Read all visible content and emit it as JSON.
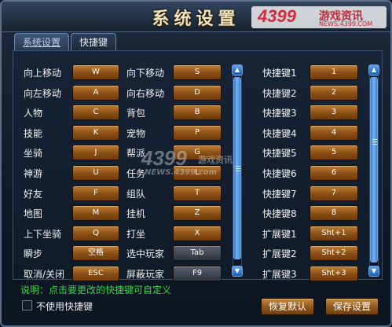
{
  "window": {
    "title": "系统设置"
  },
  "watermark": {
    "brand": "4399",
    "site": "游戏资讯",
    "url": "NEWS.4399.COM"
  },
  "center_watermark": {
    "brand": "4399",
    "site": "游戏资讯",
    "url": "NEWS.4399.com"
  },
  "tabs": [
    {
      "label": "系统设置",
      "active": true
    },
    {
      "label": "快捷键",
      "active": false
    }
  ],
  "bindings_left": [
    {
      "label": "向上移动",
      "key": "W"
    },
    {
      "label": "向左移动",
      "key": "A"
    },
    {
      "label": "人物",
      "key": "C"
    },
    {
      "label": "技能",
      "key": "K"
    },
    {
      "label": "坐骑",
      "key": "J"
    },
    {
      "label": "神游",
      "key": "U"
    },
    {
      "label": "好友",
      "key": "F"
    },
    {
      "label": "地图",
      "key": "M"
    },
    {
      "label": "上下坐骑",
      "key": "Q"
    },
    {
      "label": "瞬步",
      "key": "空格"
    },
    {
      "label": "取消/关闭",
      "key": "ESC"
    }
  ],
  "bindings_mid": [
    {
      "label": "向下移动",
      "key": "S"
    },
    {
      "label": "向右移动",
      "key": "D"
    },
    {
      "label": "背包",
      "key": "B"
    },
    {
      "label": "宠物",
      "key": "P"
    },
    {
      "label": "帮派",
      "key": "G"
    },
    {
      "label": "任务",
      "key": "L"
    },
    {
      "label": "组队",
      "key": "T"
    },
    {
      "label": "挂机",
      "key": "Z"
    },
    {
      "label": "打坐",
      "key": "X"
    },
    {
      "label": "选中玩家",
      "key": "Tab"
    },
    {
      "label": "屏蔽玩家",
      "key": "F9"
    }
  ],
  "bindings_right": [
    {
      "label": "快捷键1",
      "key": "1"
    },
    {
      "label": "快捷键2",
      "key": "2"
    },
    {
      "label": "快捷键3",
      "key": "3"
    },
    {
      "label": "快捷键4",
      "key": "4"
    },
    {
      "label": "快捷键5",
      "key": "5"
    },
    {
      "label": "快捷键6",
      "key": "6"
    },
    {
      "label": "快捷键7",
      "key": "7"
    },
    {
      "label": "快捷键8",
      "key": "8"
    },
    {
      "label": "扩展键1",
      "key": "Sht+1"
    },
    {
      "label": "扩展键2",
      "key": "Sht+2"
    },
    {
      "label": "扩展键3",
      "key": "Sht+3"
    }
  ],
  "scrollbars": [
    {
      "up_icon": "arrow-up-icon",
      "down_icon": "arrow-down-icon"
    },
    {
      "up_icon": "arrow-up-icon",
      "down_icon": "arrow-down-icon"
    }
  ],
  "footer": {
    "hint": "说明：点击要更改的快捷键可自定义",
    "checkbox_label": "不使用快捷键",
    "checkbox_checked": false,
    "restore_label": "恢复默认",
    "save_label": "保存设置"
  },
  "colors": {
    "key_button": "#8a4e14",
    "key_button_dark": "#2e333c",
    "hint_text": "#37d64a",
    "scrollbar": "#1c5fb3",
    "title_text": "#f4e4b8"
  }
}
